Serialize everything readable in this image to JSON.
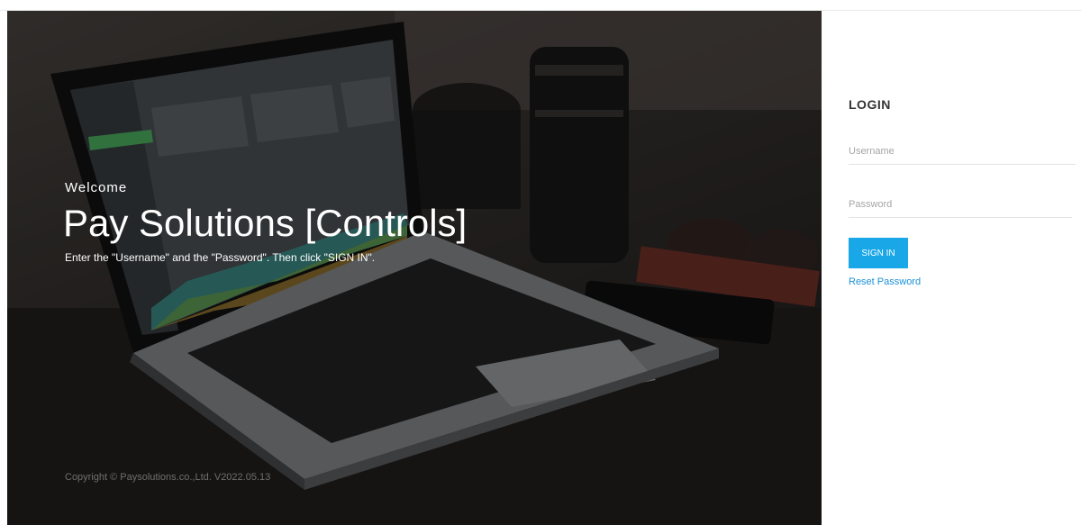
{
  "hero": {
    "welcome": "Welcome",
    "title": "Pay Solutions [Controls]",
    "instructions": "Enter the \"Username\" and the \"Password\". Then click \"SIGN IN\".",
    "copyright": "Copyright © Paysolutions.co.,Ltd. V2022.05.13"
  },
  "login": {
    "heading": "LOGIN",
    "username_placeholder": "Username",
    "username_value": "",
    "password_placeholder": "Password",
    "password_value": "",
    "signin_label": "SIGN IN",
    "reset_label": "Reset Password"
  },
  "colors": {
    "accent": "#1aa7e8",
    "link": "#1a90d8",
    "hero_background": "#2b2826"
  }
}
